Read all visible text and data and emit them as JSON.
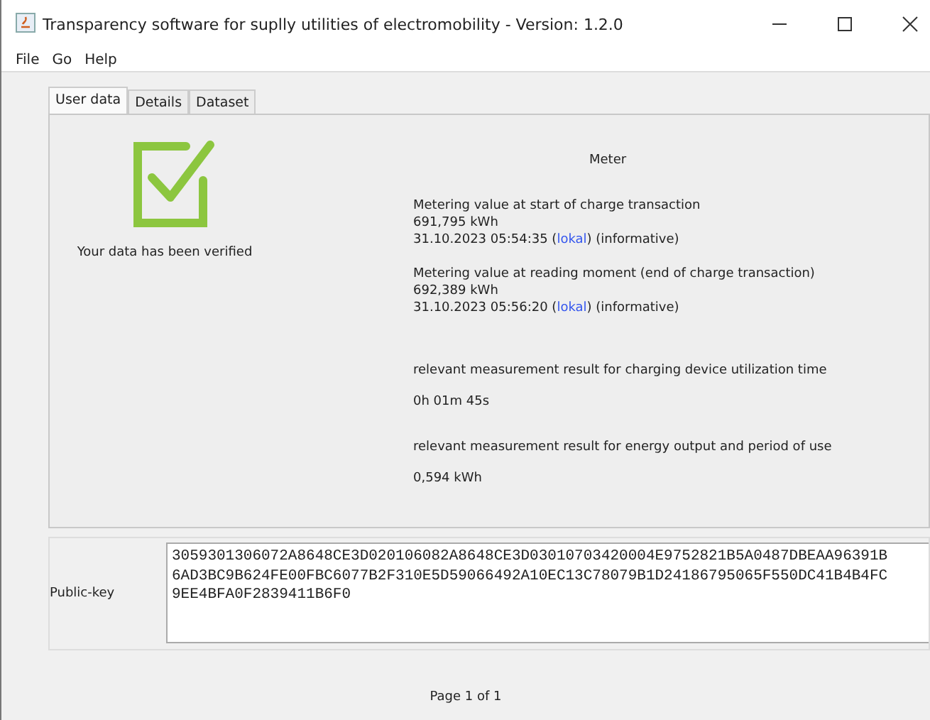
{
  "window": {
    "title": "Transparency software for suplly utilities of electromobility - Version: 1.2.0"
  },
  "menu": [
    "File",
    "Go",
    "Help"
  ],
  "tabs": [
    {
      "label": "User data",
      "selected": true
    },
    {
      "label": "Details",
      "selected": false
    },
    {
      "label": "Dataset",
      "selected": false
    }
  ],
  "verification": {
    "verified": true,
    "message": "Your data has been verified"
  },
  "meter": {
    "heading": "Meter",
    "readings": [
      {
        "label": "Metering value at start of charge transaction",
        "value": "691,795 kWh",
        "time_prefix": "31.10.2023 05:54:35 (",
        "link": "lokal",
        "time_suffix": ") (informative)"
      },
      {
        "label": "Metering value at reading moment (end of charge transaction)",
        "value": "692,389 kWh",
        "time_prefix": "31.10.2023 05:56:20 (",
        "link": "lokal",
        "time_suffix": ") (informative)"
      }
    ],
    "results": [
      {
        "label": "relevant measurement result for charging device utilization time",
        "value": "0h 01m 45s"
      },
      {
        "label": "relevant measurement result for energy output and period of use",
        "value": "0,594 kWh"
      }
    ]
  },
  "public_key": {
    "label": "Public-key",
    "lines": [
      "3059301306072A8648CE3D020106082A8648CE3D03010703420004E9752821B5A0487DBEAA96391B",
      "6AD3BC9B624FE00FBC6077B2F310E5D59066492A10EC13C78079B1D24186795065F550DC41B4B4FC",
      "9EE4BFA0F2839411B6F0"
    ]
  },
  "pager": "Page 1 of 1"
}
